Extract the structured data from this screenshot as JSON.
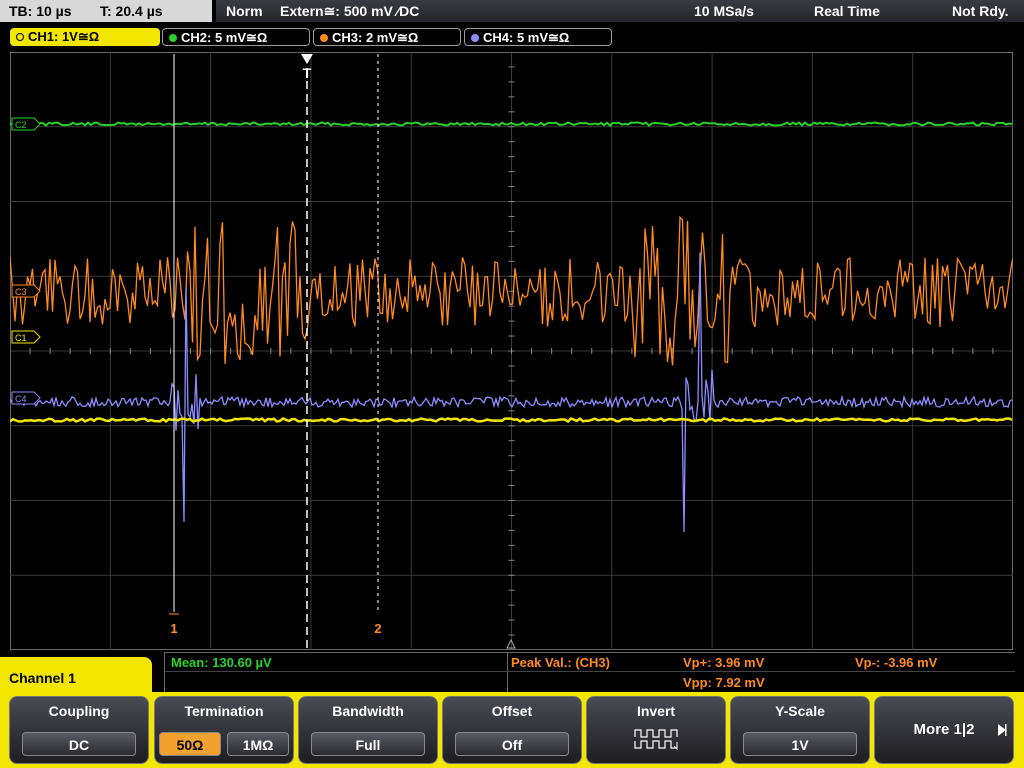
{
  "header": {
    "timebase": "TB: 10 µs",
    "trigger_time": "T: 20.4 µs",
    "mode": "Norm",
    "trigger_source": "Extern≅: 500 mV ⁄DC",
    "sample_rate": "10 MSa/s",
    "acq_mode": "Real Time",
    "status": "Not Rdy."
  },
  "channels": [
    {
      "label": "CH1: 1V≅Ω",
      "color": "#f2e600",
      "active": true
    },
    {
      "label": "CH2: 5 mV≅Ω",
      "color": "#28d228",
      "active": false
    },
    {
      "label": "CH3: 2 mV≅Ω",
      "color": "#ff8a1e",
      "active": false
    },
    {
      "label": "CH4: 5 mV≅Ω",
      "color": "#8c8cff",
      "active": false
    }
  ],
  "trace_markers": {
    "c2": "C2",
    "c3": "C3",
    "c1": "C1",
    "c4": "C4"
  },
  "trigger_marker": "T",
  "cursors": {
    "cursor1": "1",
    "cursor2": "2"
  },
  "measurements": {
    "mean": "Mean: 130.60 µV",
    "peak_label": "Peak Val.:  (CH3)",
    "vp_plus": "Vp+: 3.96 mV",
    "vp_minus": "Vp-: -3.96 mV",
    "vpp": "Vpp: 7.92 mV"
  },
  "menu": {
    "title": "Channel 1",
    "coupling": {
      "label": "Coupling",
      "value": "DC"
    },
    "termination": {
      "label": "Termination",
      "opt1": "50Ω",
      "opt2": "1MΩ"
    },
    "bandwidth": {
      "label": "Bandwidth",
      "value": "Full"
    },
    "offset": {
      "label": "Offset",
      "value": "Off"
    },
    "invert": {
      "label": "Invert",
      "icon": "invert-waveform-icon"
    },
    "yscale": {
      "label": "Y-Scale",
      "value": "1V"
    },
    "more": {
      "label": "More 1|2"
    }
  }
}
